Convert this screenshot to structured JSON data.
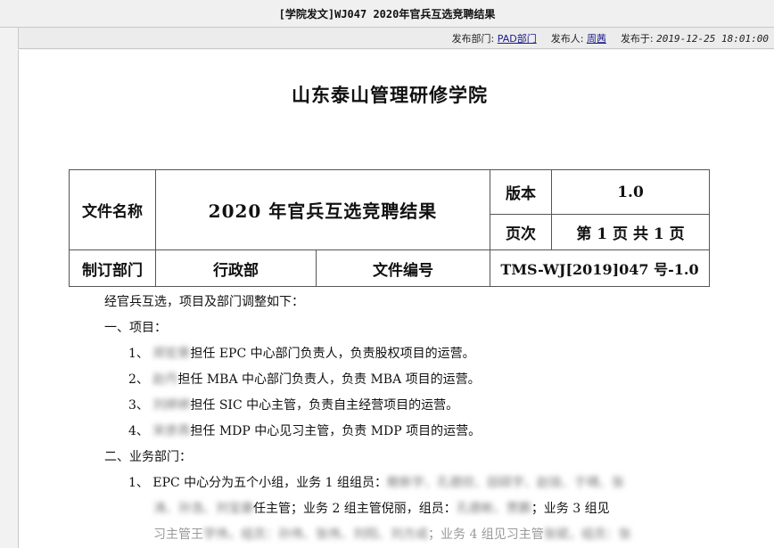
{
  "window": {
    "title": "[学院发文]WJ047 2020年官兵互选竞聘结果"
  },
  "meta": {
    "dept_label": "发布部门:",
    "dept_value": "PAD部门",
    "publisher_label": "发布人:",
    "publisher_value": "周茜",
    "time_label": "发布于:",
    "time_value": "2019-12-25 18:01:00"
  },
  "doc": {
    "org_name": "山东泰山管理研修学院",
    "header": {
      "file_name_label": "文件名称",
      "file_name_value": "2020 年官兵互选竞聘结果",
      "version_label": "版本",
      "version_value": "1.0",
      "page_label": "页次",
      "page_value": "第 1 页 共 1 页",
      "dept_label": "制订部门",
      "dept_value": "行政部",
      "doc_no_label": "文件编号",
      "doc_no_value": "TMS-WJ[2019]047 号-1.0"
    },
    "intro": "经官兵互选，项目及部门调整如下：",
    "section1_title": "一、项目：",
    "items": [
      {
        "num": "1、",
        "name": "郑宏景",
        "text": "担任 EPC 中心部门负责人，负责股权项目的运营。"
      },
      {
        "num": "2、",
        "name": "赵丹",
        "text": "担任 MBA 中心部门负责人，负责 MBA 项目的运营。"
      },
      {
        "num": "3、",
        "name": "刘婷婷",
        "text": "担任 SIC 中心主管，负责自主经营项目的运营。"
      },
      {
        "num": "4、",
        "name": "宋彦燕",
        "text": "担任 MDP 中心见习主管，负责 MDP 项目的运营。"
      }
    ],
    "section2_title": "二、业务部门：",
    "dept_item": {
      "num": "1、",
      "line1": "EPC 中心分为五个小组，业务 1 组组员：",
      "line1_names": "鲍新宇、孔德欣、田硕宇、赵琰、于晴、张",
      "line2_names": "涛、孙浩、刘宝康",
      "line2": "任主管；业务 2 组主管倪丽，组员：",
      "line2_names2": "孔德彬、贾鹏",
      "line2_end": "；业务 3 组见",
      "line3_start": "习主管王",
      "line3_names": "学伟，组员：孙伟、张伟、刘阳、刘方成",
      "line3_mid": "；业务 4 组见习主管",
      "line3_names2": "张斌，组员：张"
    }
  }
}
